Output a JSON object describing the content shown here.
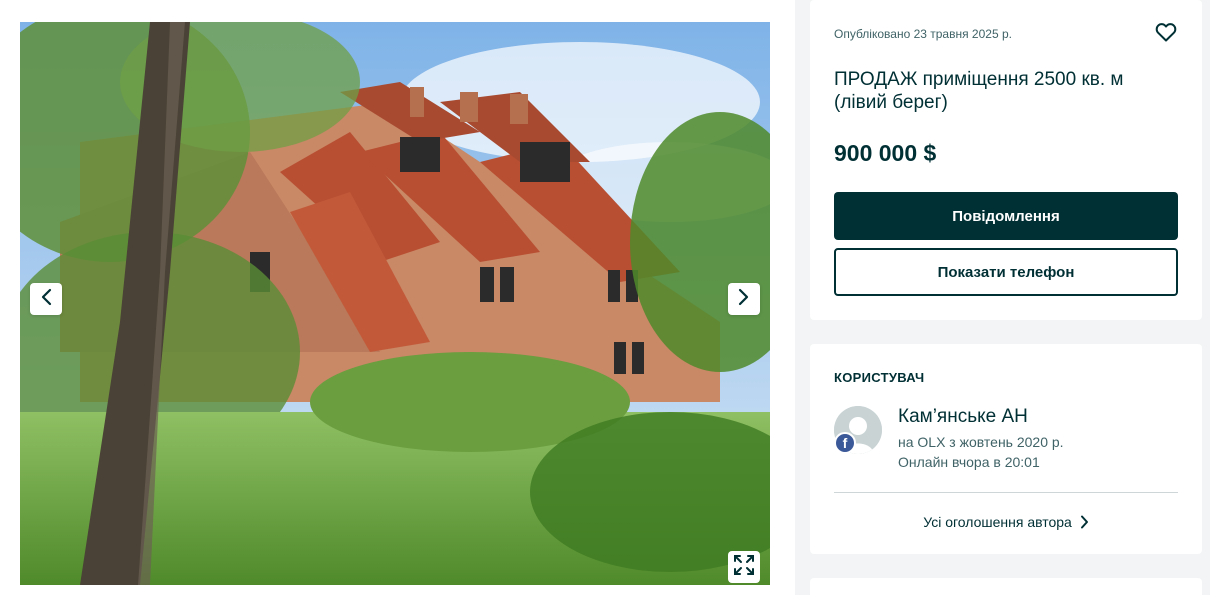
{
  "gallery": {
    "prev_icon": "chevron-left-icon",
    "next_icon": "chevron-right-icon",
    "fullscreen_icon": "expand-icon",
    "photo_subject": "abandoned brick building with tiled roof among trees"
  },
  "listing": {
    "posted": "Опубліковано 23 травня 2025 р.",
    "favorite_icon": "heart-icon",
    "title": "ПРОДАЖ приміщення 2500 кв. м (лівий берег)",
    "price": "900 000 $",
    "message_button": "Повідомлення",
    "phone_button": "Показати телефон"
  },
  "user": {
    "heading": "КОРИСТУВАЧ",
    "name": "Кам’янське АН",
    "since": "на OLX з жовтень 2020 р.",
    "online": "Онлайн вчора в 20:01",
    "fb_badge": "f",
    "all_ads": "Усі оголошення автора"
  },
  "colors": {
    "primary": "#002f34",
    "background": "#f2f4f5",
    "facebook": "#3b5998"
  }
}
